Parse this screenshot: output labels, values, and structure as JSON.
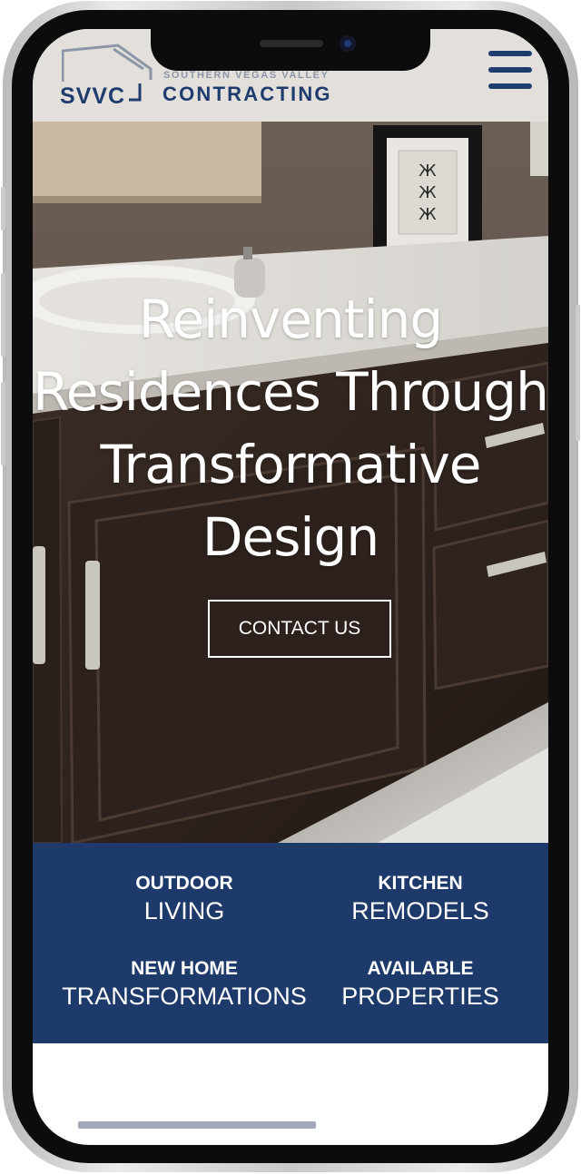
{
  "brand": {
    "mark": "SVVC",
    "subtitle": "SOUTHERN VEGAS VALLEY",
    "name": "CONTRACTING",
    "primary_color": "#1f3c6e"
  },
  "header": {
    "menu_icon": "hamburger-menu-icon"
  },
  "hero": {
    "title_lines": [
      "Reinventing",
      "Residences Through",
      "Transformative",
      "Design"
    ],
    "cta_label": "CONTACT US"
  },
  "services": [
    {
      "bold": "OUTDOOR",
      "light": "LIVING"
    },
    {
      "bold": "KITCHEN",
      "light": "REMODELS"
    },
    {
      "bold": "NEW HOME",
      "light": "TRANSFORMATIONS"
    },
    {
      "bold": "AVAILABLE",
      "light": "PROPERTIES"
    }
  ]
}
